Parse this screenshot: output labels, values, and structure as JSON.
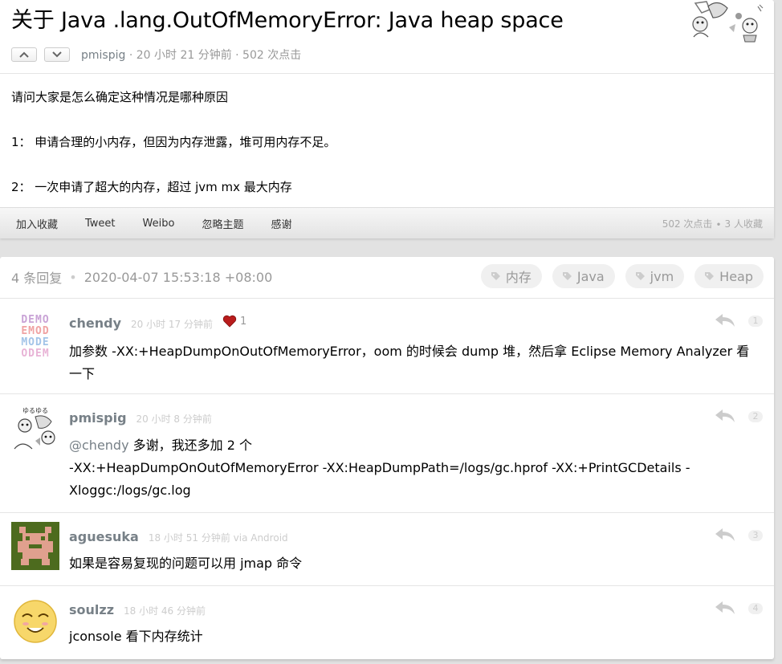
{
  "topic": {
    "title": "关于 Java .lang.OutOfMemoryError: Java heap space",
    "author": "pmispig",
    "meta_rest": " · 20 小时 21 分钟前 · 502 次点击",
    "content": [
      "请问大家是怎么确定这种情况是哪种原因",
      "1： 申请合理的小内存，但因为内存泄露，堆可用内存不足。",
      "2： 一次申请了超大的内存，超过 jvm mx 最大内存"
    ],
    "footer_links": [
      "加入收藏",
      "Tweet",
      "Weibo",
      "忽略主题",
      "感谢"
    ],
    "footer_stats": "502 次点击 ∙ 3 人收藏"
  },
  "replies_header": {
    "count": "4 条回复",
    "datetime": "2020-04-07 15:53:18 +08:00",
    "tags": [
      "内存",
      "Java",
      "jvm",
      "Heap"
    ]
  },
  "replies": [
    {
      "author": "chendy",
      "time": "20 小时 17 分钟前",
      "thanks": "1",
      "floor": "1",
      "body": "加参数 -XX:+HeapDumpOnOutOfMemoryError，oom 的时候会 dump 堆，然后拿 Eclipse Memory Analyzer 看一下"
    },
    {
      "author": "pmispig",
      "time": "20 小时 8 分钟前",
      "floor": "2",
      "mention": "@chendy",
      "body_line1": " 多谢，我还多加 2 个",
      "body_rest": "-XX:+HeapDumpOnOutOfMemoryError -XX:HeapDumpPath=/logs/gc.hprof -XX:+PrintGCDetails -Xloggc:/logs/gc.log"
    },
    {
      "author": "aguesuka",
      "time": "18 小时 51 分钟前 via Android",
      "floor": "3",
      "body": "如果是容易复现的问题可以用 jmap 命令"
    },
    {
      "author": "soulzz",
      "time": "18 小时 46 分钟前",
      "floor": "4",
      "body": "jconsole 看下内存统计"
    }
  ],
  "colors": {
    "background": "#e2e2e2",
    "link_gray": "#778087",
    "heart": "#cc2222"
  }
}
